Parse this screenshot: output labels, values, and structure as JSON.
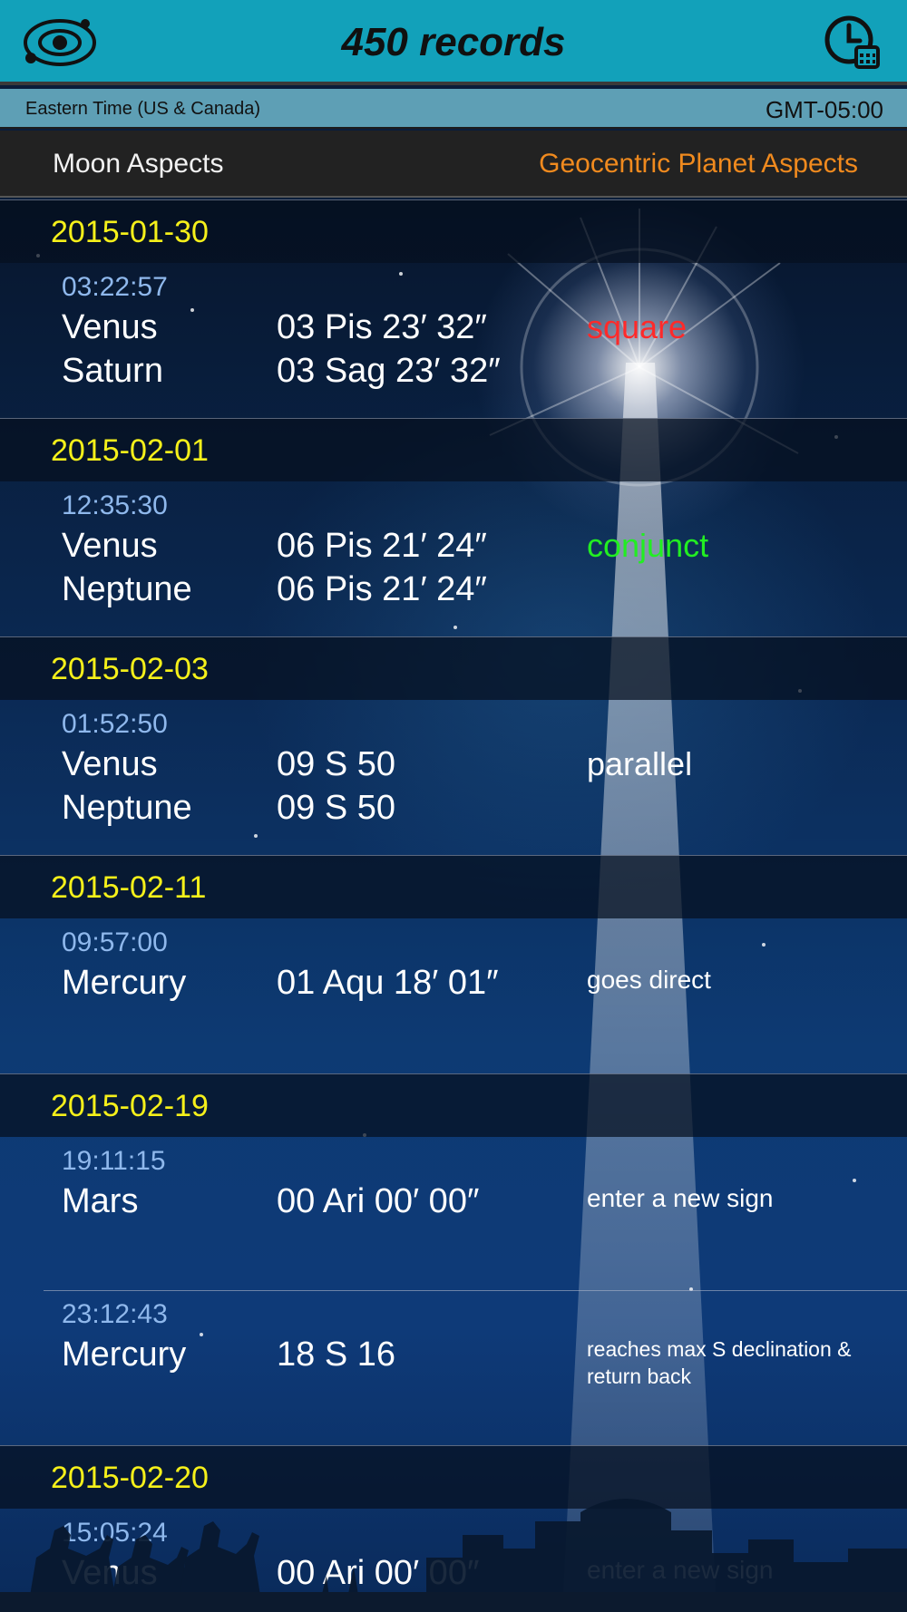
{
  "header": {
    "title": "450 records"
  },
  "timezone": {
    "name": "Eastern Time (US & Canada)",
    "offset": "GMT-05:00"
  },
  "tabs": {
    "moon": "Moon Aspects",
    "geocentric": "Geocentric Planet Aspects"
  },
  "colors": {
    "date": "#f5f01a",
    "time": "#8fb8ec",
    "square": "#ff2a2a",
    "conjunct": "#22ee22",
    "active_tab": "#f08a1e",
    "header": "#12a1ba"
  },
  "groups": [
    {
      "date": "2015-01-30",
      "entries": [
        {
          "time": "03:22:57",
          "planets": [
            "Venus",
            "Saturn"
          ],
          "positions": [
            "03 Pis 23′ 32″",
            "03 Sag 23′ 32″"
          ],
          "aspect": "square"
        }
      ]
    },
    {
      "date": "2015-02-01",
      "entries": [
        {
          "time": "12:35:30",
          "planets": [
            "Venus",
            "Neptune"
          ],
          "positions": [
            "06 Pis 21′ 24″",
            "06 Pis 21′ 24″"
          ],
          "aspect": "conjunct"
        }
      ]
    },
    {
      "date": "2015-02-03",
      "entries": [
        {
          "time": "01:52:50",
          "planets": [
            "Venus",
            "Neptune"
          ],
          "positions": [
            "09 S 50",
            "09 S 50"
          ],
          "aspect": "parallel"
        }
      ]
    },
    {
      "date": "2015-02-11",
      "entries": [
        {
          "time": "09:57:00",
          "planets": [
            "Mercury"
          ],
          "positions": [
            "01 Aqu 18′ 01″"
          ],
          "aspect": "goes direct"
        }
      ]
    },
    {
      "date": "2015-02-19",
      "entries": [
        {
          "time": "19:11:15",
          "planets": [
            "Mars"
          ],
          "positions": [
            "00 Ari 00′ 00″"
          ],
          "aspect": "enter a new sign"
        },
        {
          "time": "23:12:43",
          "planets": [
            "Mercury"
          ],
          "positions": [
            "18 S 16"
          ],
          "aspect": "reaches max S declination & return back"
        }
      ]
    },
    {
      "date": "2015-02-20",
      "entries": [
        {
          "time": "15:05:24",
          "planets": [
            "Venus"
          ],
          "positions": [
            "00 Ari 00′ 00″"
          ],
          "aspect": "enter a new sign"
        }
      ]
    }
  ]
}
